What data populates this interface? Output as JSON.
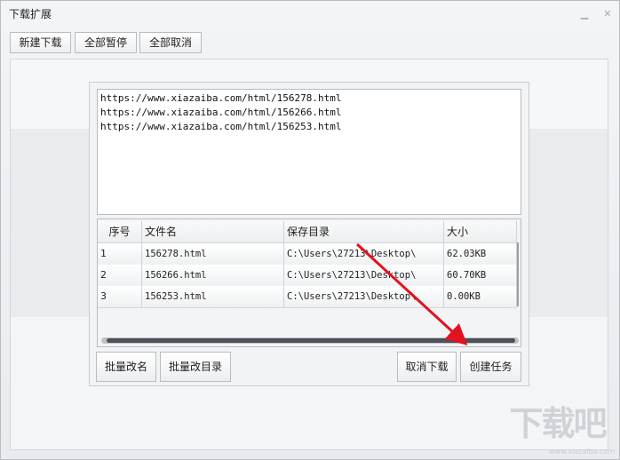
{
  "window": {
    "title": "下载扩展"
  },
  "toolbar": {
    "new_label": "新建下载",
    "pause_all_label": "全部暂停",
    "cancel_all_label": "全部取消"
  },
  "urls": [
    "https://www.xiazaiba.com/html/156278.html",
    "https://www.xiazaiba.com/html/156266.html",
    "https://www.xiazaiba.com/html/156253.html"
  ],
  "table": {
    "headers": [
      "序号",
      "文件名",
      "保存目录",
      "大小"
    ],
    "rows": [
      [
        "1",
        "156278.html",
        "C:\\Users\\27213\\Desktop\\",
        "62.03KB"
      ],
      [
        "2",
        "156266.html",
        "C:\\Users\\27213\\Desktop\\",
        "60.70KB"
      ],
      [
        "3",
        "156253.html",
        "C:\\Users\\27213\\Desktop\\",
        "0.00KB"
      ]
    ]
  },
  "buttons": {
    "batch_rename": "批量改名",
    "batch_dir": "批量改目录",
    "cancel_download": "取消下载",
    "create_task": "创建任务"
  },
  "watermark": {
    "text": "下载吧",
    "sub": "www.xiazaiba.com"
  },
  "colors": {
    "annotation_arrow": "#e0141e"
  },
  "icons": {
    "minimize": "minimize-icon",
    "close": "close-icon"
  }
}
